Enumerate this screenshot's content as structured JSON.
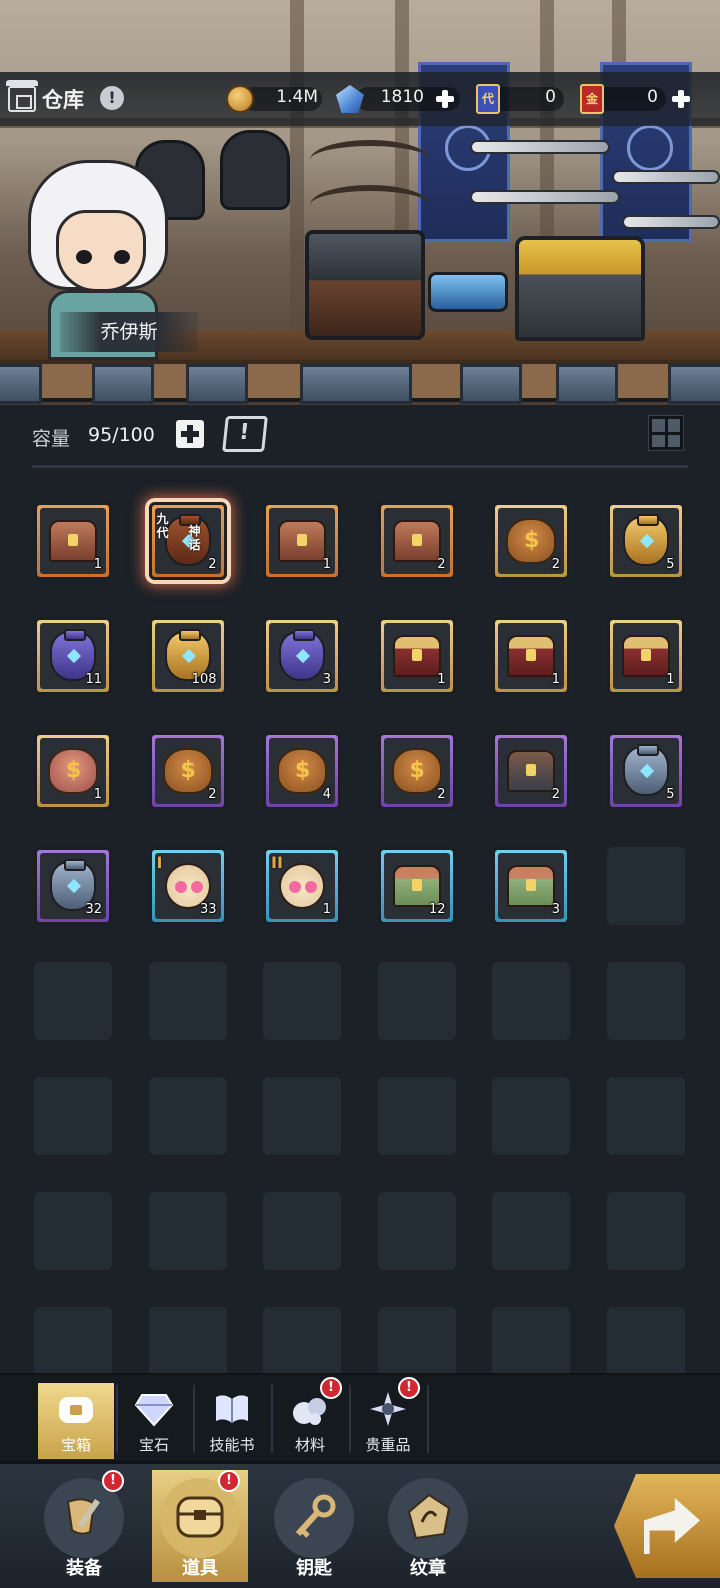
{
  "header": {
    "title": "仓库",
    "info_icon": "info-icon",
    "resources": [
      {
        "name": "gold",
        "icon": "coin-icon",
        "value": "1.4M"
      },
      {
        "name": "crystal",
        "icon": "crystal-icon",
        "value": "1810"
      },
      {
        "name": "dai-card",
        "icon": "card-icon",
        "glyph": "代",
        "value": "0"
      },
      {
        "name": "jin-card",
        "icon": "card-icon",
        "glyph": "金",
        "value": "0"
      }
    ]
  },
  "character": {
    "name": "乔伊斯"
  },
  "capacity": {
    "label": "容量",
    "value": "95/100"
  },
  "items": [
    {
      "frame": "orange",
      "art": "chest",
      "count": "1"
    },
    {
      "frame": "orange",
      "art": "jar",
      "count": "2",
      "tags": [
        "九代",
        "神话"
      ],
      "selected": true
    },
    {
      "frame": "orange",
      "art": "chest",
      "count": "1"
    },
    {
      "frame": "orange",
      "art": "chest",
      "count": "2"
    },
    {
      "frame": "gold",
      "art": "bag",
      "count": "2"
    },
    {
      "frame": "gold",
      "art": "vase-gold",
      "count": "5"
    },
    {
      "frame": "gold",
      "art": "vase-purple",
      "count": "11"
    },
    {
      "frame": "gold",
      "art": "vase-gold",
      "count": "108"
    },
    {
      "frame": "gold",
      "art": "vase-purple",
      "count": "3"
    },
    {
      "frame": "gold",
      "art": "chest-red",
      "count": "1"
    },
    {
      "frame": "gold",
      "art": "chest-red",
      "count": "1"
    },
    {
      "frame": "gold",
      "art": "chest-red",
      "count": "1"
    },
    {
      "frame": "gold",
      "art": "gift",
      "count": "1"
    },
    {
      "frame": "purple",
      "art": "bag",
      "count": "2"
    },
    {
      "frame": "purple",
      "art": "bag",
      "count": "4"
    },
    {
      "frame": "purple",
      "art": "bag",
      "count": "2"
    },
    {
      "frame": "purple",
      "art": "chest-dark",
      "count": "2"
    },
    {
      "frame": "purple",
      "art": "vase-silver",
      "count": "5"
    },
    {
      "frame": "purple",
      "art": "vase-silver",
      "count": "32"
    },
    {
      "frame": "blue",
      "art": "pouch",
      "count": "33",
      "roman": "I"
    },
    {
      "frame": "blue",
      "art": "pouch",
      "count": "1",
      "roman": "II"
    },
    {
      "frame": "blue",
      "art": "chest-green",
      "count": "12"
    },
    {
      "frame": "blue",
      "art": "chest-green",
      "count": "3"
    }
  ],
  "empty_slots": 25,
  "categories": [
    {
      "label": "宝箱",
      "icon": "chest-icon",
      "active": true,
      "alert": false
    },
    {
      "label": "宝石",
      "icon": "gem-icon",
      "active": false,
      "alert": false
    },
    {
      "label": "技能书",
      "icon": "book-icon",
      "active": false,
      "alert": false
    },
    {
      "label": "材料",
      "icon": "material-icon",
      "active": false,
      "alert": true
    },
    {
      "label": "贵重品",
      "icon": "valuables-icon",
      "active": false,
      "alert": true
    }
  ],
  "nav": [
    {
      "label": "装备",
      "icon": "equipment-icon",
      "active": false,
      "alert": true
    },
    {
      "label": "道具",
      "icon": "items-icon",
      "active": true,
      "alert": true
    },
    {
      "label": "钥匙",
      "icon": "key-icon",
      "active": false,
      "alert": false
    },
    {
      "label": "纹章",
      "icon": "emblem-icon",
      "active": false,
      "alert": false
    }
  ],
  "share_icon": "share-arrow-icon",
  "alert_glyph": "!",
  "colors": {
    "background": "#1b2127",
    "frame_orange": "#d8873f",
    "frame_gold": "#d3b463",
    "frame_purple": "#8a5cc2",
    "frame_blue": "#4fb3d0",
    "active_tab": "#dcbc6a",
    "alert_red": "#d02830"
  }
}
